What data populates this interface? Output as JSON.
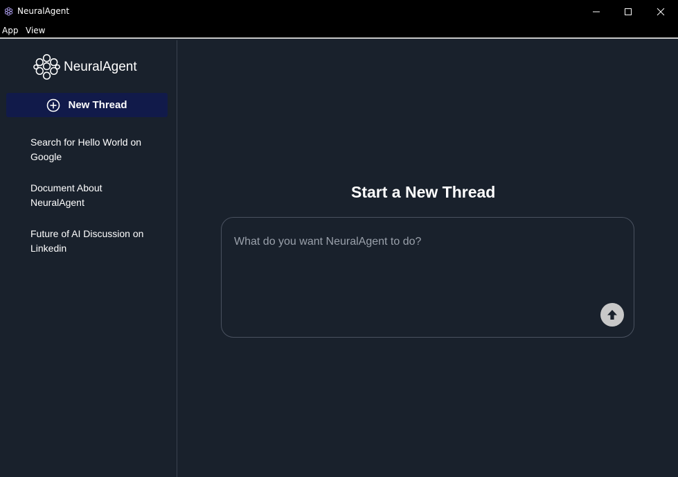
{
  "window": {
    "title": "NeuralAgent",
    "icon": "neuralagent-logo-icon"
  },
  "menubar": {
    "items": [
      "App",
      "View"
    ]
  },
  "sidebar": {
    "logo_text": "NeuralAgent",
    "new_thread_label": "New Thread",
    "threads": [
      {
        "label": "Search for Hello World on Google"
      },
      {
        "label": "Document About NeuralAgent"
      },
      {
        "label": "Future of AI Discussion on Linkedin"
      }
    ]
  },
  "main": {
    "title": "Start a New Thread",
    "prompt_placeholder": "What do you want NeuralAgent to do?",
    "prompt_value": ""
  },
  "colors": {
    "background": "#19212c",
    "titlebar": "#000000",
    "new_thread_button": "#111a4a",
    "send_button": "#c8c8c8"
  }
}
